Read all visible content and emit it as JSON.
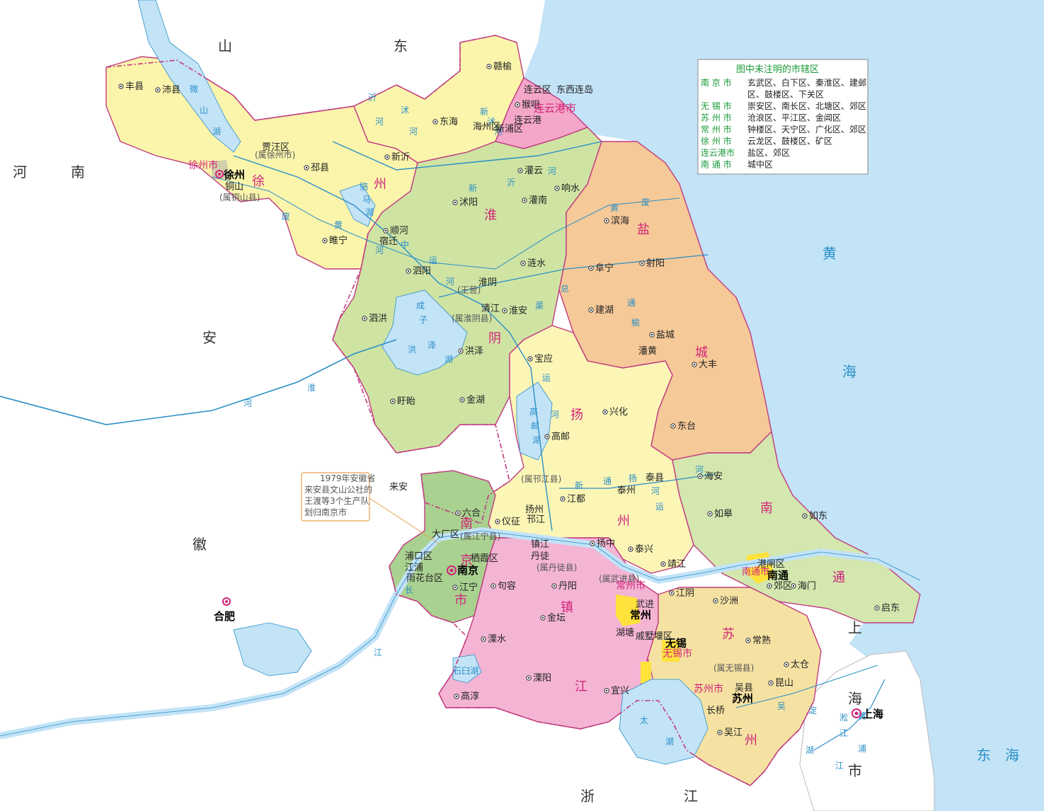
{
  "neighbors": {
    "shandong": [
      "山",
      "东"
    ],
    "henan": [
      "河",
      "南"
    ],
    "anhui": [
      "安",
      "徽"
    ],
    "zhejiang": [
      "浙",
      "江"
    ],
    "shanghai_big": [
      "上",
      "海"
    ]
  },
  "seas": {
    "yellow_sea": [
      "黄",
      "海"
    ],
    "east_sea": [
      "东",
      "海"
    ]
  },
  "prefectures": {
    "xuzhou": [
      "徐",
      "州"
    ],
    "huaiyin": [
      "淮",
      "阴"
    ],
    "yancheng": [
      "盐",
      "城"
    ],
    "yangzhou": [
      "扬",
      "州"
    ],
    "nantong": [
      "南",
      "通"
    ],
    "nanjing": [
      "南",
      "京",
      "市"
    ],
    "zhenjiang": [
      "镇",
      "江"
    ],
    "suzhou": [
      "苏",
      "州"
    ]
  },
  "cities": {
    "xuzhou_city": "徐州市",
    "xuzhou": "徐州",
    "lianyungang_city": "连云港市",
    "nanjing": "南京",
    "hefei": "合肥",
    "shanghai": "上海",
    "changzhou_city": "常州市",
    "changzhou": "常州",
    "wuxi_city": "无锡市",
    "wuxi": "无锡",
    "suzhou_city": "苏州市",
    "suzhou": "苏州",
    "nantong_city": "南通市",
    "nantong": "南通"
  },
  "counties": [
    "丰县",
    "沛县",
    "贾汪区",
    "(属徐州市)",
    "邳县",
    "铜山",
    "(属铜山县)",
    "新沂",
    "东海",
    "海州区",
    "赣榆",
    "连云区",
    "东西连岛",
    "猴咀",
    "连云港",
    "新浦区",
    "灌云",
    "沭阳",
    "灌南",
    "响水",
    "滨海",
    "阜宁",
    "射阳",
    "建湖",
    "盐城",
    "潘黄",
    "大丰",
    "东台",
    "宿迁",
    "顺河",
    "睢宁",
    "泗阳",
    "涟水",
    "淮阴",
    "(王营)",
    "清江",
    "淮安",
    "(属淮阴县)",
    "泗洪",
    "洪泽",
    "宝应",
    "盱眙",
    "金湖",
    "高邮",
    "兴化",
    "来安",
    "(属邗江县)",
    "江都",
    "泰州",
    "泰县",
    "海安",
    "如皋",
    "如东",
    "六合",
    "仪征",
    "扬州",
    "邗江",
    "大厂区",
    "(属江宁县)",
    "栖霞区",
    "浦口区",
    "江浦",
    "雨花台区",
    "江宁",
    "镇江",
    "丹徒",
    "(属丹徒县)",
    "扬中",
    "泰兴",
    "靖江",
    "句容",
    "丹阳",
    "(属武进县)",
    "武进",
    "金坛",
    "湖塘",
    "戚墅堰区",
    "江阴",
    "沙洲",
    "常熟",
    "太仓",
    "昆山",
    "(属无锡县)",
    "吴县",
    "长桥",
    "吴江",
    "港闸区",
    "郊区",
    "海门",
    "启东",
    "溧水",
    "溧阳",
    "宜兴",
    "高淳"
  ],
  "rivers": {
    "weishan": [
      "微",
      "山",
      "湖"
    ],
    "yi": [
      "沂",
      "河"
    ],
    "shu": [
      "沭",
      "河"
    ],
    "xinyi": [
      "新",
      "沂",
      "河"
    ],
    "xinshu": [
      "新",
      "沭",
      "河"
    ],
    "huang_fei": [
      "黄",
      "废"
    ],
    "yellow_old": [
      "废",
      "黄",
      "河"
    ],
    "luoma": [
      "骆",
      "马",
      "湖"
    ],
    "zhongyun": [
      "中",
      "运",
      "河"
    ],
    "hongze": [
      "洪",
      "泽",
      "湖"
    ],
    "huai": [
      "淮",
      "河"
    ],
    "chengzi": [
      "成",
      "子",
      "湖"
    ],
    "zongqu": [
      "总",
      "渠"
    ],
    "tongyu": [
      "通",
      "榆",
      "河"
    ],
    "gaoyou": [
      "高",
      "邮",
      "湖"
    ],
    "yun": [
      "运",
      "河"
    ],
    "xintong": [
      "新",
      "通",
      "扬",
      "运",
      "河"
    ],
    "chang": [
      "长",
      "江"
    ],
    "tai": [
      "太",
      "湖"
    ],
    "shijiu": [
      "石",
      "臼",
      "湖"
    ],
    "huangpu": [
      "黄",
      "浦",
      "江"
    ],
    "dianshan": [
      "淀",
      "湖"
    ],
    "wusong": [
      "吴",
      "淞",
      "江"
    ]
  },
  "legend": {
    "title": "图中未注明的市辖区",
    "rows": [
      {
        "city": "南 京 市",
        "districts": [
          "玄武区、白下区、秦淮区、建邺",
          "区、鼓楼区、下关区"
        ]
      },
      {
        "city": "无 锡 市",
        "districts": [
          "崇安区、南长区、北塘区、郊区"
        ]
      },
      {
        "city": "苏 州 市",
        "districts": [
          "沧浪区、平江区、金阊区"
        ]
      },
      {
        "city": "常 州 市",
        "districts": [
          "钟楼区、天宁区、广化区、郊区"
        ]
      },
      {
        "city": "徐 州 市",
        "districts": [
          "云龙区、鼓楼区、矿区"
        ]
      },
      {
        "city": "连云港市",
        "districts": [
          "盐区、郊区"
        ]
      },
      {
        "city": "南 通 市",
        "districts": [
          "城中区"
        ]
      }
    ]
  },
  "callout": {
    "lines": [
      "1979年安徽省",
      "来安县文山公社的",
      "王渡等3个生产队",
      "划归南京市"
    ]
  },
  "colors": {
    "sea": "#c3e3f7",
    "xuzhou": "#fbf5ac",
    "huaiyin": "#cfe3a3",
    "yancheng": "#f6c998",
    "yangzhou": "#fcf6b6",
    "nantong": "#d3e7ae",
    "nanjing": "#a9d190",
    "zhenjiang": "#f4b5d4",
    "suzhou": "#f5e2a2",
    "lianyungang": "#f4a7c8",
    "city_yellow": "#ffe23c",
    "water": "#c3e3f7",
    "river": "#2a8fc7",
    "boundary": "#c03a80"
  }
}
